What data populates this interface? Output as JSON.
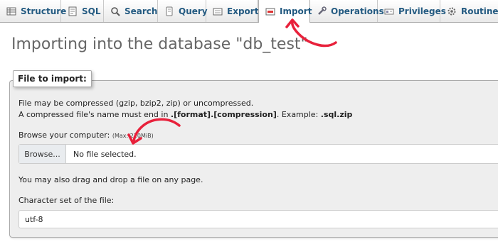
{
  "tabs": [
    {
      "label": "Structure",
      "icon": "structure-icon"
    },
    {
      "label": "SQL",
      "icon": "sql-icon"
    },
    {
      "label": "Search",
      "icon": "search-icon"
    },
    {
      "label": "Query",
      "icon": "query-icon"
    },
    {
      "label": "Export",
      "icon": "export-icon"
    },
    {
      "label": "Import",
      "icon": "import-icon",
      "active": true
    },
    {
      "label": "Operations",
      "icon": "wrench-icon"
    },
    {
      "label": "Privileges",
      "icon": "privileges-icon"
    },
    {
      "label": "Routines",
      "icon": "gear-icon"
    }
  ],
  "page": {
    "title": "Importing into the database \"db_test\""
  },
  "file_import": {
    "legend": "File to import:",
    "compress_note": "File may be compressed (gzip, bzip2, zip) or uncompressed.",
    "name_note_prefix": "A compressed file's name must end in ",
    "name_note_format": ".[format].[compression]",
    "name_note_example_label": ". Example: ",
    "name_note_example": ".sql.zip",
    "browse_label": "Browse your computer:",
    "browse_max": "(Max: 220MiB)",
    "browse_button": "Browse...",
    "file_status": "No file selected.",
    "drag_note": "You may also drag and drop a file on any page.",
    "charset_label": "Character set of the file:",
    "charset_value": "utf-8"
  },
  "colors": {
    "tab_text": "#235a81",
    "annotation": "#e8213b"
  }
}
